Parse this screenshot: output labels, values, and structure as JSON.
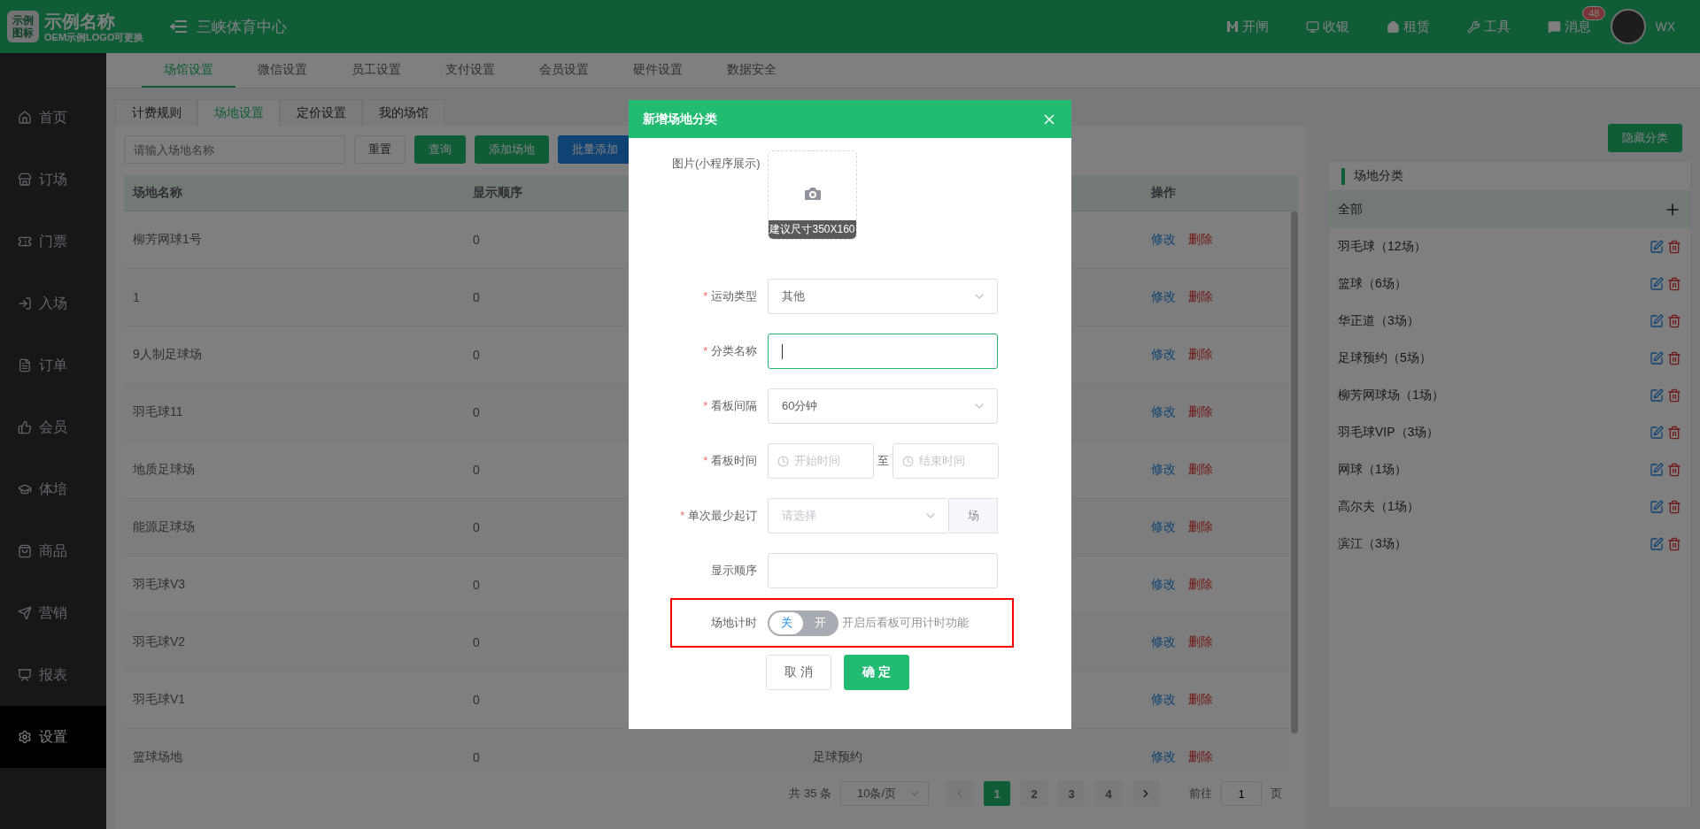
{
  "header": {
    "logo_mark": "示例图标",
    "logo_title": "示例名称",
    "logo_subtitle": "OEM示例LOGO可更换",
    "venue": "三峡体育中心",
    "actions": [
      {
        "label": "开闸"
      },
      {
        "label": "收银"
      },
      {
        "label": "租赁"
      },
      {
        "label": "工具"
      },
      {
        "label": "消息",
        "badge": "48"
      }
    ],
    "user": "WX"
  },
  "sidebar": {
    "items": [
      {
        "label": "首页",
        "selected": false
      },
      {
        "label": "订场",
        "selected": false
      },
      {
        "label": "门票",
        "selected": false
      },
      {
        "label": "入场",
        "selected": false
      },
      {
        "label": "订单",
        "selected": false
      },
      {
        "label": "会员",
        "selected": false
      },
      {
        "label": "体培",
        "selected": false
      },
      {
        "label": "商品",
        "selected": false
      },
      {
        "label": "营销",
        "selected": false
      },
      {
        "label": "报表",
        "selected": false
      },
      {
        "label": "设置",
        "selected": true
      }
    ]
  },
  "top_tabs": [
    {
      "label": "场馆设置",
      "selected": true
    },
    {
      "label": "微信设置",
      "selected": false
    },
    {
      "label": "员工设置",
      "selected": false
    },
    {
      "label": "支付设置",
      "selected": false
    },
    {
      "label": "会员设置",
      "selected": false
    },
    {
      "label": "硬件设置",
      "selected": false
    },
    {
      "label": "数据安全",
      "selected": false
    }
  ],
  "sub_tabs": [
    {
      "label": "计费规则",
      "selected": false
    },
    {
      "label": "场地设置",
      "selected": true
    },
    {
      "label": "定价设置",
      "selected": false
    },
    {
      "label": "我的场馆",
      "selected": false
    }
  ],
  "toolbar": {
    "search_placeholder": "请输入场地名称",
    "buttons": [
      {
        "label": "重置",
        "kind": "default"
      },
      {
        "label": "查询",
        "kind": "primary"
      },
      {
        "label": "添加场地",
        "kind": "primary"
      },
      {
        "label": "批量添加",
        "kind": "blue"
      }
    ],
    "hide_button": "隐藏分类"
  },
  "table": {
    "columns": [
      "场地名称",
      "显示顺序"
    ],
    "actions_column": "操作",
    "rows": [
      {
        "name": "柳芳网球1号",
        "order": "0",
        "actions": [
          "修改",
          "删除"
        ]
      },
      {
        "name": "1",
        "order": "0",
        "actions": [
          "修改",
          "删除"
        ]
      },
      {
        "name": "9人制足球场",
        "order": "0",
        "actions": [
          "修改",
          "删除"
        ]
      },
      {
        "name": "羽毛球11",
        "order": "0",
        "actions": [
          "修改",
          "删除"
        ]
      },
      {
        "name": "地质足球场",
        "order": "0",
        "actions": [
          "修改",
          "删除"
        ]
      },
      {
        "name": "能源足球场",
        "order": "0",
        "actions": [
          "修改",
          "删除"
        ]
      },
      {
        "name": "羽毛球V3",
        "order": "0",
        "actions": [
          "修改",
          "删除"
        ]
      },
      {
        "name": "羽毛球V2",
        "order": "0",
        "actions": [
          "修改",
          "删除"
        ]
      },
      {
        "name": "羽毛球V1",
        "order": "0",
        "actions": [
          "修改",
          "删除"
        ]
      },
      {
        "name": "篮球场地",
        "order": "0",
        "column_3": "足球预约",
        "actions": [
          "修改",
          "删除"
        ]
      }
    ]
  },
  "pagination": {
    "total": "共 35 条",
    "page_size": "10条/页",
    "pages": [
      {
        "label": "1",
        "selected": true
      },
      {
        "label": "2",
        "selected": false
      },
      {
        "label": "3",
        "selected": false
      },
      {
        "label": "4",
        "selected": false
      }
    ],
    "goto_label": "前往",
    "goto_value": "1",
    "page_unit": "页"
  },
  "categories": {
    "title": "场地分类",
    "items": [
      {
        "label": "全部",
        "kind": "all",
        "selected": true
      },
      {
        "label": "羽毛球（12场）",
        "kind": "category",
        "selected": false
      },
      {
        "label": "篮球（6场）",
        "kind": "category",
        "selected": false
      },
      {
        "label": "华正道（3场）",
        "kind": "category",
        "selected": false
      },
      {
        "label": "足球预约（5场）",
        "kind": "category",
        "selected": false
      },
      {
        "label": "柳芳网球场（1场）",
        "kind": "category",
        "selected": false
      },
      {
        "label": "羽毛球VIP（3场）",
        "kind": "category",
        "selected": false
      },
      {
        "label": "网球（1场）",
        "kind": "category",
        "selected": false
      },
      {
        "label": "高尔夫（1场）",
        "kind": "category",
        "selected": false
      },
      {
        "label": "滨江（3场）",
        "kind": "category",
        "selected": false
      }
    ]
  },
  "dialog": {
    "title": "新增场地分类",
    "required_mark": "*",
    "fields": [
      {
        "kind": "upload",
        "label": "图片(小程序展示)",
        "hint": "建议尺寸350X160"
      },
      {
        "kind": "select",
        "label": "运动类型",
        "required": true,
        "value": "其他"
      },
      {
        "kind": "text",
        "label": "分类名称",
        "required": true,
        "focused": true
      },
      {
        "kind": "select",
        "label": "看板间隔",
        "required": true,
        "value": "60分钟"
      },
      {
        "kind": "timerange",
        "label": "看板时间",
        "required": true,
        "start_placeholder": "开始时间",
        "separator": "至",
        "end_placeholder": "结束时间"
      },
      {
        "kind": "select_addon",
        "label": "单次最少起订",
        "required": true,
        "placeholder": "请选择",
        "addon": "场"
      },
      {
        "kind": "text",
        "label": "显示顺序",
        "required": false,
        "focused": false
      },
      {
        "kind": "switch",
        "label": "场地计时",
        "off_label": "关",
        "on_label": "开",
        "on": false,
        "hint": "开启后看板可用计时功能",
        "highlighted": true
      }
    ],
    "buttons": [
      {
        "label": "取 消",
        "kind": "default"
      },
      {
        "label": "确 定",
        "kind": "primary"
      }
    ]
  }
}
